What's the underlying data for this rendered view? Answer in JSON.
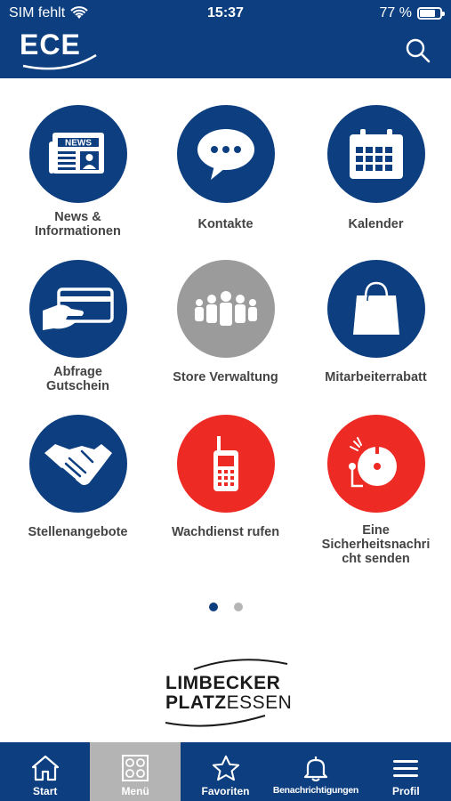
{
  "status_bar": {
    "carrier": "SIM fehlt",
    "time": "15:37",
    "battery": "77 %",
    "battery_level": 0.77
  },
  "header": {
    "logo_text": "ECE",
    "search_icon": "search-icon"
  },
  "menu": {
    "items": [
      {
        "label": "News &\nInformationen",
        "icon": "news-icon",
        "color": "#0d3f80"
      },
      {
        "label": "Kontakte",
        "icon": "chat-bubble-icon",
        "color": "#0d3f80"
      },
      {
        "label": "Kalender",
        "icon": "calendar-icon",
        "color": "#0d3f80"
      },
      {
        "label": "Abfrage\nGutschein",
        "icon": "card-hand-icon",
        "color": "#0d3f80"
      },
      {
        "label": "Store Verwaltung",
        "icon": "people-group-icon",
        "color": "#9b9b9b"
      },
      {
        "label": "Mitarbeiterrabatt",
        "icon": "shopping-bag-icon",
        "color": "#0d3f80"
      },
      {
        "label": "Stellenangebote",
        "icon": "handshake-icon",
        "color": "#0d3f80"
      },
      {
        "label": "Wachdienst rufen",
        "icon": "walkie-talkie-icon",
        "color": "#ee2a24"
      },
      {
        "label": "Eine\nSicherheitsnachri\ncht senden",
        "icon": "alarm-bell-icon",
        "color": "#ee2a24"
      }
    ]
  },
  "pager": {
    "pages": 2,
    "current": 1
  },
  "brand": {
    "line1": "LIMBECKER",
    "line2_bold": "PLATZ",
    "line2_light": "ESSEN"
  },
  "tabbar": {
    "tabs": [
      {
        "label": "Start",
        "icon": "home-icon"
      },
      {
        "label": "Menü",
        "icon": "grid-icon",
        "active": true
      },
      {
        "label": "Favoriten",
        "icon": "star-icon"
      },
      {
        "label": "Benachrichtigungen",
        "icon": "bell-icon"
      },
      {
        "label": "Profil",
        "icon": "hamburger-icon"
      }
    ]
  }
}
